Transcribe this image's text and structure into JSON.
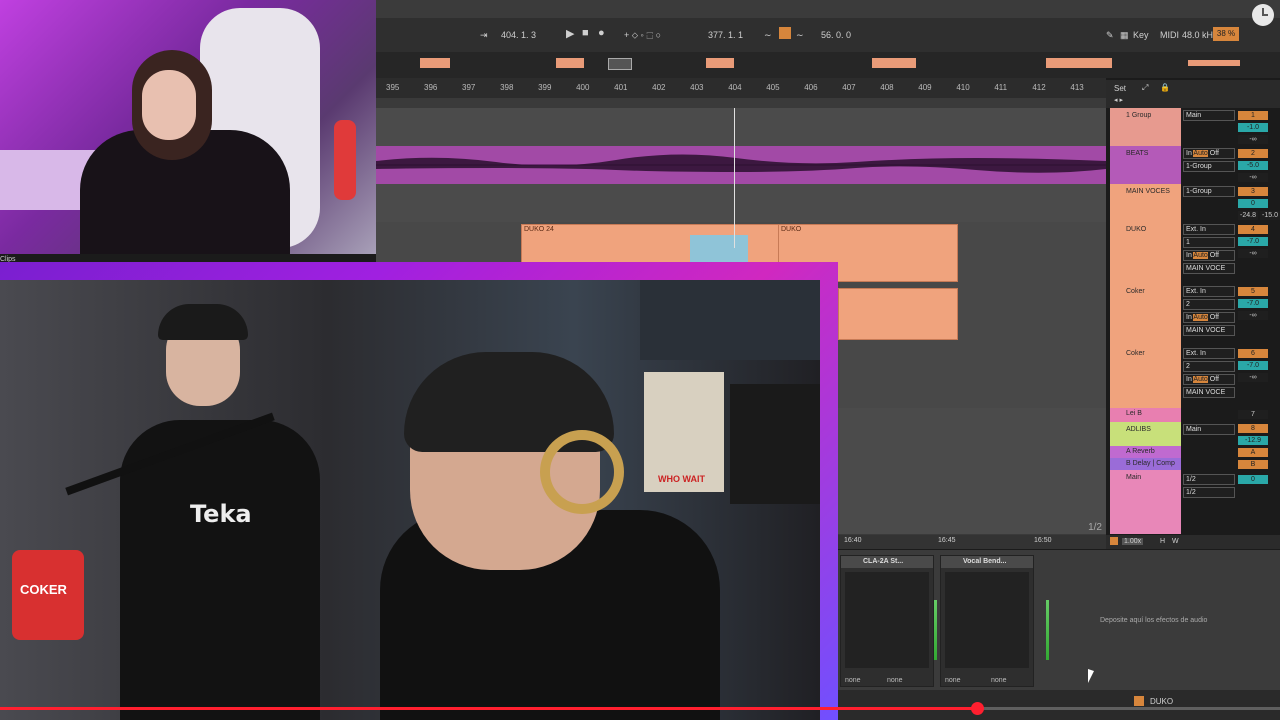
{
  "transport": {
    "arrangement_position": "404.  1.  3",
    "loop_length": "377.  1.  1",
    "loop_end": "56.  0.  0",
    "key_label": "Key",
    "midi_label": "MIDI",
    "sample_rate": "48.0 kHz",
    "cpu_label": "38 %"
  },
  "ruler": {
    "bars": [
      "395",
      "396",
      "397",
      "398",
      "399",
      "400",
      "401",
      "402",
      "403",
      "404",
      "405",
      "406",
      "407",
      "408",
      "409",
      "410",
      "411",
      "412",
      "413"
    ]
  },
  "clips": {
    "duko_24": "DUKO 24",
    "duko": "DUKO"
  },
  "set_header": {
    "label": "Set"
  },
  "tracks": [
    {
      "name": "1 Group",
      "color": "#e79a8f"
    },
    {
      "name": "BEATS",
      "color": "#b45ab8"
    },
    {
      "name": "MAIN VOCES",
      "color": "#f0a37d"
    },
    {
      "name": "DUKO",
      "color": "#f0a37d"
    },
    {
      "name": "Coker",
      "color": "#f0a37d"
    },
    {
      "name": "Coker",
      "color": "#f0a37d"
    },
    {
      "name": "Lei B",
      "color": "#e87fb0"
    },
    {
      "name": "ADLIBS",
      "color": "#c8e07a"
    },
    {
      "name": "A Reverb",
      "color": "#c06ad0"
    },
    {
      "name": "B Delay | Comp",
      "color": "#9a6cd8"
    },
    {
      "name": "Main",
      "color": "#e887b8"
    }
  ],
  "routing": {
    "main": "Main",
    "in": "In",
    "auto": "Auto",
    "off": "Off",
    "group1": "1-Group",
    "ext_in": "Ext. In",
    "ch1": "1",
    "ch2": "2",
    "main_voces": "MAIN VOCE",
    "out12": "1/2"
  },
  "mixer_numbers": {
    "tn": [
      "1",
      "2",
      "3",
      "4",
      "5",
      "6",
      "7",
      "8",
      "A",
      "B",
      "0"
    ],
    "vol": [
      "-1.0",
      "-5.0",
      "0",
      "-7.0",
      "-7.0",
      "-7.0",
      "-12.9"
    ],
    "inf": "-∞",
    "extra": "-24.8",
    "extra2": "-15.0"
  },
  "page_indicator": "1/2",
  "timeline": {
    "t1": "16:40",
    "t2": "16:45",
    "t3": "16:50"
  },
  "status": {
    "zoom": "1.00x",
    "h": "H",
    "w": "W"
  },
  "devices": [
    {
      "name": "CLA-2A St...",
      "foot1": "none",
      "foot2": "none"
    },
    {
      "name": "Vocal Bend...",
      "foot1": "none",
      "foot2": "none"
    }
  ],
  "drop_text": "Deposite aquí los efectos de audio",
  "bottom_clip_name": "DUKO",
  "cam_overlay_text": "Clips",
  "jersey_text": "Teka",
  "cup_text": "COKER",
  "poster_text": "WHO WAIT",
  "video_progress": 0.763,
  "colors": {
    "accent": "#ff1f2f",
    "clip": "#f0a37d",
    "beats": "#b45ab8"
  }
}
